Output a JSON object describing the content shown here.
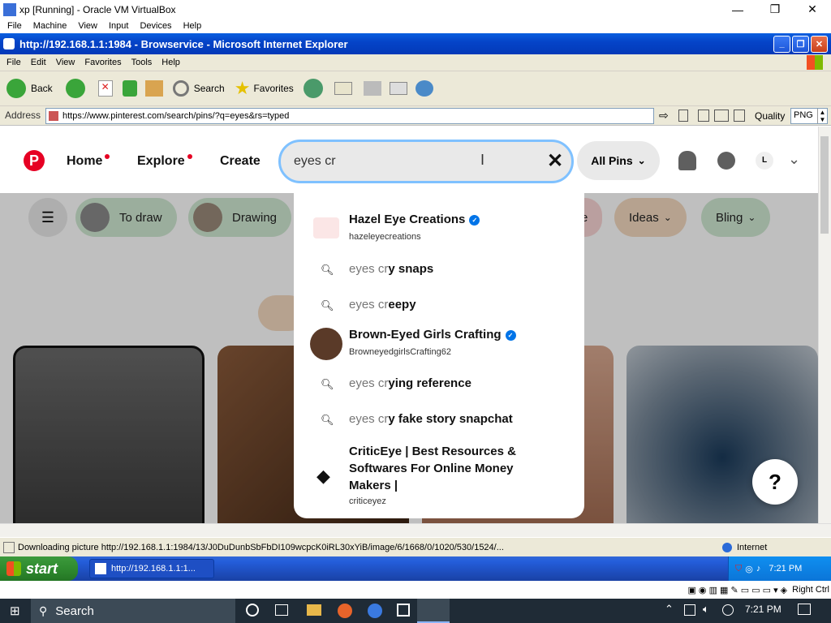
{
  "vbox": {
    "title": "xp [Running] - Oracle VM VirtualBox",
    "menu": [
      "File",
      "Machine",
      "View",
      "Input",
      "Devices",
      "Help"
    ],
    "status_right": "Right Ctrl"
  },
  "ie": {
    "title": "http://192.168.1.1:1984 - Browservice - Microsoft Internet Explorer",
    "menu": [
      "File",
      "Edit",
      "View",
      "Favorites",
      "Tools",
      "Help"
    ],
    "toolbar": {
      "back": "Back",
      "search": "Search",
      "favorites": "Favorites"
    },
    "address_label": "Address",
    "address_url": "https://www.pinterest.com/search/pins/?q=eyes&rs=typed",
    "quality_label": "Quality",
    "quality_value": "PNG",
    "status_text": "Downloading picture http://192.168.1.1:1984/13/J0DuDunbSbFbDI109wcpcK0iRL30xYiB/image/6/1668/0/1020/530/1524/...",
    "zone": "Internet"
  },
  "pinterest": {
    "nav": {
      "home": "Home",
      "explore": "Explore",
      "create": "Create"
    },
    "search_value": "eyes cr",
    "all_pins": "All Pins",
    "avatar_letter": "L",
    "chips": [
      {
        "label": "To draw",
        "color": "#cfe8d2"
      },
      {
        "label": "Drawing",
        "color": "#cfe8d2"
      },
      {
        "label": "e",
        "color": "#f8d4d4"
      },
      {
        "label": "Ideas",
        "color": "#f3d9bf"
      },
      {
        "label": "Bling",
        "color": "#cfe8d2"
      }
    ],
    "suggestions": [
      {
        "type": "profile",
        "name": "Hazel Eye Creations",
        "handle": "hazeleyecreations",
        "verified": true
      },
      {
        "type": "query",
        "prefix": "eyes cr",
        "rest": "y snaps"
      },
      {
        "type": "query",
        "prefix": "eyes cr",
        "rest": "eepy"
      },
      {
        "type": "profile",
        "name": "Brown-Eyed Girls Crafting",
        "handle": "BrowneyedgirlsCrafting62",
        "verified": true
      },
      {
        "type": "query",
        "prefix": "eyes cr",
        "rest": "ying reference"
      },
      {
        "type": "query",
        "prefix": "eyes cr",
        "rest": "y fake story snapchat"
      },
      {
        "type": "profile",
        "name": "CriticEye | Best Resources & Softwares For Online Money Makers |",
        "handle": "criticeyez",
        "verified": false
      }
    ],
    "help_label": "?"
  },
  "xp_taskbar": {
    "start": "start",
    "task": "http://192.168.1.1:1...",
    "time": "7:21 PM"
  },
  "win10": {
    "search": "Search",
    "time": "7:21 PM"
  },
  "colors": {
    "pinterest_red": "#e60023",
    "xp_blue": "#0544c8",
    "search_focus": "#7fc1ff"
  }
}
